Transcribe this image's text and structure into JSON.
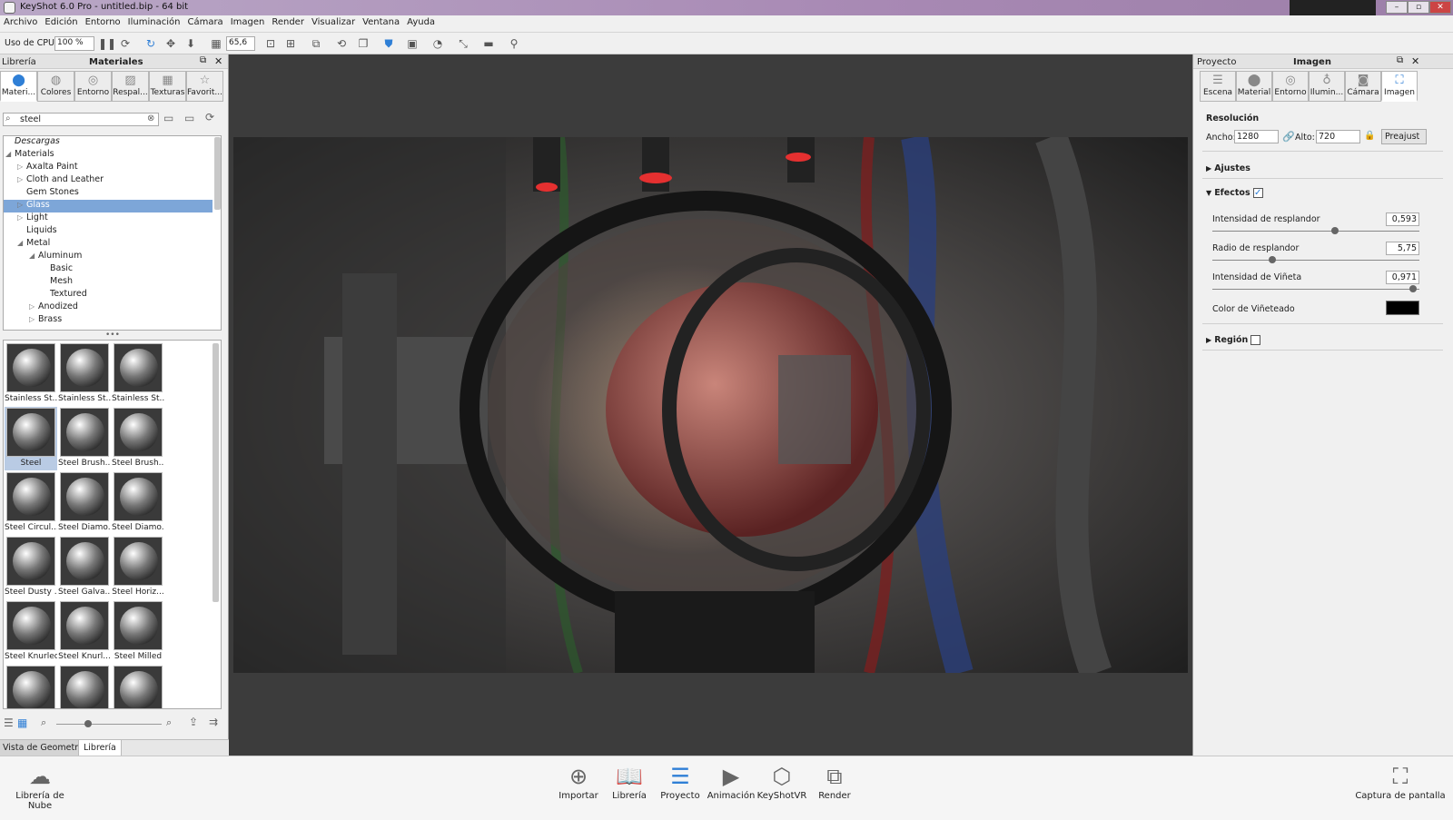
{
  "titlebar": {
    "title": "KeyShot 6.0 Pro  - untitled.bip  - 64 bit"
  },
  "menu": [
    "Archivo",
    "Edición",
    "Entorno",
    "Iluminación",
    "Cámara",
    "Imagen",
    "Render",
    "Visualizar",
    "Ventana",
    "Ayuda"
  ],
  "toolbar": {
    "cpu_label": "Uso de CPU",
    "cpu_value": "100 %",
    "fov_value": "65,6"
  },
  "left_panel": {
    "header_left": "Librería",
    "header_title": "Materiales",
    "tabs": [
      {
        "label": "Materi...",
        "icon": "material-ball-icon"
      },
      {
        "label": "Colores",
        "icon": "palette-icon"
      },
      {
        "label": "Entorno",
        "icon": "globe-icon"
      },
      {
        "label": "Respal...",
        "icon": "image-icon"
      },
      {
        "label": "Texturas",
        "icon": "checker-icon"
      },
      {
        "label": "Favorit...",
        "icon": "star-icon"
      }
    ],
    "search_value": "steel",
    "tree": [
      {
        "label": "Descargas",
        "level": 0,
        "arrow": "",
        "italic": true
      },
      {
        "label": "Materials",
        "level": 0,
        "arrow": "down"
      },
      {
        "label": "Axalta Paint",
        "level": 1,
        "arrow": "right"
      },
      {
        "label": "Cloth and Leather",
        "level": 1,
        "arrow": "right"
      },
      {
        "label": "Gem Stones",
        "level": 1,
        "arrow": ""
      },
      {
        "label": "Glass",
        "level": 1,
        "arrow": "right",
        "selected": true
      },
      {
        "label": "Light",
        "level": 1,
        "arrow": "right"
      },
      {
        "label": "Liquids",
        "level": 1,
        "arrow": ""
      },
      {
        "label": "Metal",
        "level": 1,
        "arrow": "down"
      },
      {
        "label": "Aluminum",
        "level": 2,
        "arrow": "down"
      },
      {
        "label": "Basic",
        "level": 3,
        "arrow": ""
      },
      {
        "label": "Mesh",
        "level": 3,
        "arrow": ""
      },
      {
        "label": "Textured",
        "level": 3,
        "arrow": ""
      },
      {
        "label": "Anodized",
        "level": 2,
        "arrow": "right"
      },
      {
        "label": "Brass",
        "level": 2,
        "arrow": "right"
      }
    ],
    "thumbnails": [
      "Stainless St...",
      "Stainless St...",
      "Stainless St...",
      "Steel",
      "Steel Brush...",
      "Steel Brush...",
      "Steel Circul...",
      "Steel Diamo...",
      "Steel Diamo...",
      "Steel Dusty ...",
      "Steel Galva...",
      "Steel Horiz...",
      "Steel Knurled",
      "Steel Knurl...",
      "Steel Milled",
      "",
      "",
      ""
    ],
    "selected_thumb": 3,
    "bottom_tabs": [
      "Vista de Geometría",
      "Librería"
    ],
    "zoom_level": 0.3
  },
  "right_panel": {
    "header_left": "Proyecto",
    "header_title": "Imagen",
    "tabs": [
      {
        "label": "Escena",
        "icon": "scene-list-icon"
      },
      {
        "label": "Material",
        "icon": "material-ball-icon"
      },
      {
        "label": "Entorno",
        "icon": "globe-icon"
      },
      {
        "label": "Ilumin...",
        "icon": "bulb-icon"
      },
      {
        "label": "Cámara",
        "icon": "camera-icon"
      },
      {
        "label": "Imagen",
        "icon": "frame-icon"
      }
    ],
    "resolution_label": "Resolución",
    "width_label": "Ancho:",
    "width_value": "1280",
    "height_label": "Alto:",
    "height_value": "720",
    "preset_label": "Preajust",
    "adjust_label": "Ajustes",
    "effects_label": "Efectos",
    "effects": [
      {
        "label": "Intensidad de resplandor",
        "value": "0,593",
        "level": 0.593
      },
      {
        "label": "Radio de resplandor",
        "value": "5,75",
        "level": 0.29
      },
      {
        "label": "Intensidad de Viñeta",
        "value": "0,971",
        "level": 0.971
      }
    ],
    "vignette_color_label": "Color de Viñeteado",
    "vignette_color": "#000000",
    "region_label": "Región"
  },
  "bottom_bar": {
    "cloud_label": "Librería de Nube",
    "buttons": [
      {
        "label": "Importar",
        "icon": "import-icon"
      },
      {
        "label": "Librería",
        "icon": "book-icon",
        "active": true
      },
      {
        "label": "Proyecto",
        "icon": "list-icon",
        "active": true
      },
      {
        "label": "Animación",
        "icon": "play-icon"
      },
      {
        "label": "KeyShotVR",
        "icon": "cube-icon"
      },
      {
        "label": "Render",
        "icon": "render-icon"
      }
    ],
    "screenshot_label": "Captura de pantalla"
  },
  "colors": {
    "accent": "#2f7fd6",
    "selection": "#7da6d8"
  }
}
